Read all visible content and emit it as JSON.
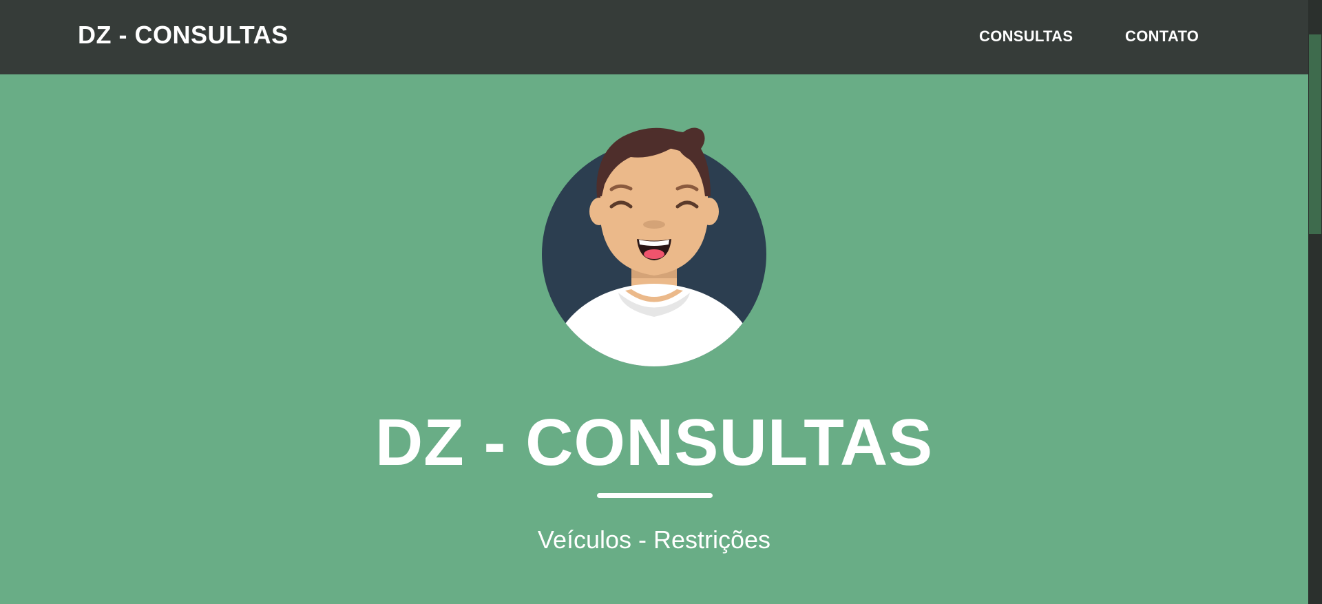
{
  "navbar": {
    "brand": "DZ - CONSULTAS",
    "links": [
      {
        "label": "CONSULTAS"
      },
      {
        "label": "CONTATO"
      }
    ]
  },
  "masthead": {
    "avatar_icon": "smiling-man-avatar-icon",
    "title": "DZ - CONSULTAS",
    "subtitle": "Veículos - Restrições"
  },
  "colors": {
    "navbar_bg": "#363c39",
    "page_bg": "#69ad86",
    "text": "#ffffff",
    "avatar_circle": "#2c3e50",
    "hair": "#4e2e2b",
    "skin": "#ebb98a"
  }
}
